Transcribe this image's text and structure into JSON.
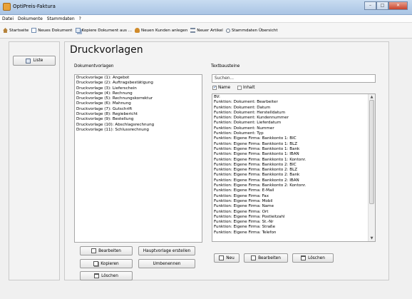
{
  "window": {
    "title": "OptiPreis-Faktura",
    "min": "–",
    "max": "□",
    "close": "✕"
  },
  "menu": [
    "Datei",
    "Dokumente",
    "Stammdaten",
    "?"
  ],
  "toolbar": [
    {
      "label": "Startseite",
      "icon": "home-icon",
      "color": "#b5823a"
    },
    {
      "label": "Neues Dokument",
      "icon": "new-document-icon",
      "color": "#6f8bb0"
    },
    {
      "label": "Kopiere Dokument aus ...",
      "icon": "copy-document-icon",
      "color": "#6f8bb0"
    },
    {
      "label": "Neuen Kunden anlegen",
      "icon": "new-customer-icon",
      "color": "#d08b2b"
    },
    {
      "label": "Neuer Artikel",
      "icon": "new-article-icon",
      "color": "#7a8aa0"
    },
    {
      "label": "Stammdaten Übersicht",
      "icon": "search-icon",
      "color": "#6b7a8e"
    }
  ],
  "sidebar": {
    "liste_label": "Liste"
  },
  "main": {
    "title": "Druckvorlagen",
    "dokumentvorlagen_label": "Dokumentvorlagen",
    "textbausteine_label": "Textbausteine",
    "search_placeholder": "Suchen...",
    "check_name": "Name",
    "check_inhalt": "Inhalt",
    "templates": [
      "Druckvorlage (1): Angebot",
      "Druckvorlage (2): Auftragsbestätigung",
      "Druckvorlage (3): Lieferschein",
      "Druckvorlage (4): Rechnung",
      "Druckvorlage (5): Rechnungskorrektur",
      "Druckvorlage (6): Mahnung",
      "Druckvorlage (7): Gutschrift",
      "Druckvorlage (8): Regiebericht",
      "Druckvorlage (9): Bestellung",
      "Druckvorlage (10): Abschlagsrechnung",
      "Druckvorlage (11): Schlussrechnung"
    ],
    "textbausteine": [
      "BV:",
      "Funktion: Dokument: Bearbeiter",
      "Funktion: Dokument: Datum",
      "Funktion: Dokument: Herstelldatum",
      "Funktion: Dokument: Kundennummer",
      "Funktion: Dokument: Lieferdatum",
      "Funktion: Dokument: Nummer",
      "Funktion: Dokument: Typ",
      "Funktion: Eigene Firma: Bankkonto 1: BIC",
      "Funktion: Eigene Firma: Bankkonto 1: BLZ",
      "Funktion: Eigene Firma: Bankkonto 1: Bank",
      "Funktion: Eigene Firma: Bankkonto 1: IBAN",
      "Funktion: Eigene Firma: Bankkonto 1: Kontonr.",
      "Funktion: Eigene Firma: Bankkonto 2: BIC",
      "Funktion: Eigene Firma: Bankkonto 2: BLZ",
      "Funktion: Eigene Firma: Bankkonto 2: Bank",
      "Funktion: Eigene Firma: Bankkonto 2: IBAN",
      "Funktion: Eigene Firma: Bankkonto 2: Kontonr.",
      "Funktion: Eigene Firma: E-Mail",
      "Funktion: Eigene Firma: Fax",
      "Funktion: Eigene Firma: Mobil",
      "Funktion: Eigene Firma: Name",
      "Funktion: Eigene Firma: Ort",
      "Funktion: Eigene Firma: Postleitzahl",
      "Funktion: Eigene Firma: St.-Nr",
      "Funktion: Eigene Firma: Straße",
      "Funktion: Eigene Firma: Telefon"
    ],
    "buttons": {
      "bearbeiten": "Bearbeiten",
      "hauptvorlage": "Hauptvorlage erstellen",
      "kopieren": "Kopieren",
      "umbenennen": "Umbenennen",
      "loeschen": "Löschen",
      "neu": "Neu",
      "tb_bearbeiten": "Bearbeiten",
      "tb_loeschen": "Löschen"
    }
  }
}
